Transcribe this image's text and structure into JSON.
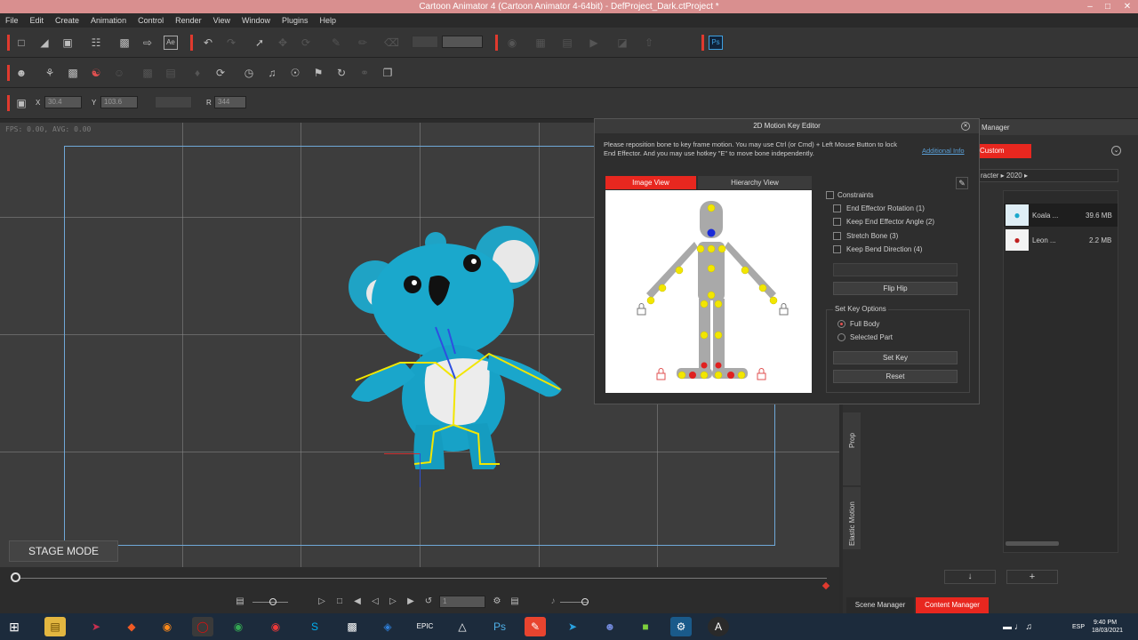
{
  "window": {
    "title": "Cartoon Animator 4  (Cartoon Animator 4-64bit) - DefProject_Dark.ctProject *",
    "minimize": "–",
    "maximize": "□",
    "close": "✕"
  },
  "menu": [
    "File",
    "Edit",
    "Create",
    "Animation",
    "Control",
    "Render",
    "View",
    "Window",
    "Plugins",
    "Help"
  ],
  "transform": {
    "x_label": "X",
    "x_value": "30.4",
    "y_label": "Y",
    "y_value": "103.6",
    "r_label": "R",
    "r_value": "344"
  },
  "viewport": {
    "fps_text": "FPS: 0.00, AVG: 0.00",
    "stage_mode": "STAGE MODE"
  },
  "timeline": {
    "frame_value": "1"
  },
  "motion_editor": {
    "title": "2D Motion Key Editor",
    "instruction": "Please reposition bone to key frame motion. You may use Ctrl (or Cmd) + Left Mouse Button to lock End Effector. And you may use hotkey \"E\" to move bone independently.",
    "additional_info": "Additional Info",
    "tabs": {
      "image_view": "Image View",
      "hierarchy_view": "Hierarchy View"
    },
    "constraints": {
      "header": "Constraints",
      "items": [
        "End Effector Rotation (1)",
        "Keep End Effector Angle (2)",
        "Stretch Bone (3)",
        "Keep Bend Direction (4)"
      ]
    },
    "flip_hip": "Flip Hip",
    "set_key_options": {
      "header": "Set Key Options",
      "full_body": "Full Body",
      "selected_part": "Selected Part"
    },
    "set_key": "Set Key",
    "reset": "Reset"
  },
  "content_manager": {
    "title_partial": "Manager",
    "custom_tab": "Custom",
    "breadcrumb_a": "racter",
    "breadcrumb_b": "2020",
    "items": [
      {
        "name": "Koala ...",
        "size": "39.6 MB"
      },
      {
        "name": "Leon ...",
        "size": "2.2 MB"
      }
    ],
    "side_tabs": {
      "prop": "Prop",
      "elastic": "Elastic Motion"
    },
    "bottom_tabs": {
      "scene": "Scene Manager",
      "content": "Content Manager"
    }
  },
  "taskbar": {
    "lang": "ESP",
    "time": "9:40 PM",
    "date": "18/03/2021"
  },
  "colors": {
    "accent": "#e03a2e",
    "joint": "#f2e600",
    "dialog_bg": "#2e2e2e",
    "taskbar": "#1c2b3c"
  }
}
